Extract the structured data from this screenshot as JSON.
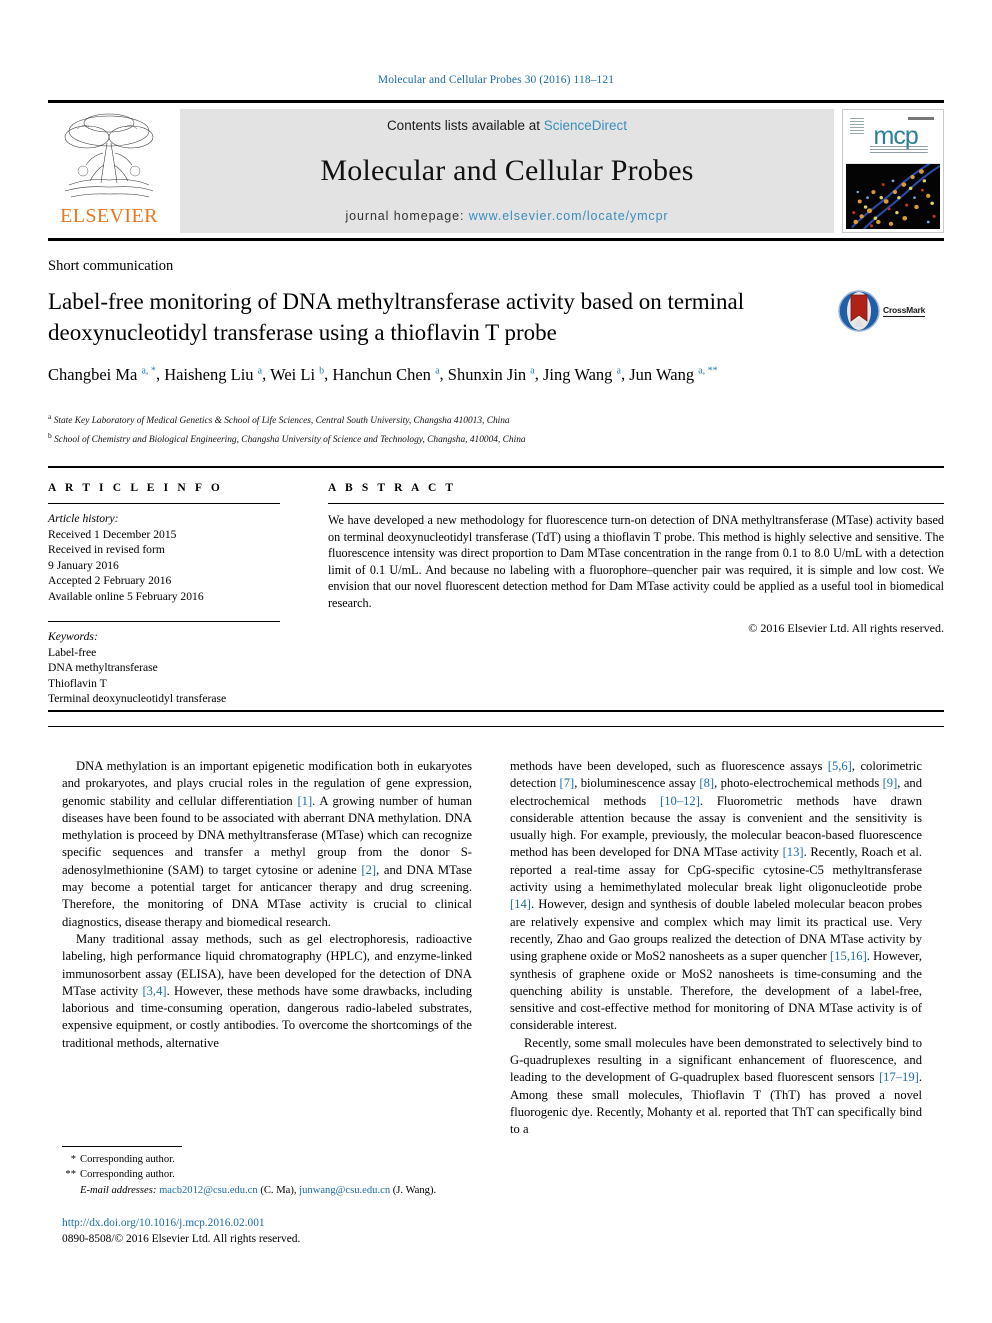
{
  "running_head": "Molecular and Cellular Probes 30 (2016) 118–121",
  "masthead": {
    "contents_prefix": "Contents lists available at ",
    "sciencedirect": "ScienceDirect",
    "journal_title": "Molecular and Cellular Probes",
    "homepage_prefix": "journal homepage: ",
    "homepage_url": "www.elsevier.com/locate/ymcpr",
    "publisher": "ELSEVIER",
    "cover_mark": "mcp"
  },
  "article": {
    "type": "Short communication",
    "title": "Label-free monitoring of DNA methyltransferase activity based on terminal deoxynucleotidyl transferase using a thioflavin T probe",
    "crossmark_label": "CrossMark",
    "authors_line_1": "Changbei Ma",
    "authors": [
      {
        "name": "Changbei Ma",
        "marks": "a, *"
      },
      {
        "name": "Haisheng Liu",
        "marks": "a"
      },
      {
        "name": "Wei Li",
        "marks": "b"
      },
      {
        "name": "Hanchun Chen",
        "marks": "a"
      },
      {
        "name": "Shunxin Jin",
        "marks": "a"
      },
      {
        "name": "Jing Wang",
        "marks": "a"
      },
      {
        "name": "Jun Wang",
        "marks": "a, **"
      }
    ],
    "affiliations": [
      {
        "mark": "a",
        "text": "State Key Laboratory of Medical Genetics & School of Life Sciences, Central South University, Changsha 410013, China"
      },
      {
        "mark": "b",
        "text": "School of Chemistry and Biological Engineering, Changsha University of Science and Technology, Changsha, 410004, China"
      }
    ]
  },
  "info": {
    "heading": "A R T I C L E   I N F O",
    "history_label": "Article history:",
    "history": [
      "Received 1 December 2015",
      "Received in revised form",
      "9 January 2016",
      "Accepted 2 February 2016",
      "Available online 5 February 2016"
    ],
    "keywords_label": "Keywords:",
    "keywords": [
      "Label-free",
      "DNA methyltransferase",
      "Thioflavin T",
      "Terminal deoxynucleotidyl transferase"
    ]
  },
  "abstract": {
    "heading": "A B S T R A C T",
    "text": "We have developed a new methodology for fluorescence turn-on detection of DNA methyltransferase (MTase) activity based on terminal deoxynucleotidyl transferase (TdT) using a thioflavin T probe. This method is highly selective and sensitive. The fluorescence intensity was direct proportion to Dam MTase concentration in the range from 0.1 to 8.0 U/mL with a detection limit of 0.1 U/mL. And because no labeling with a fluorophore–quencher pair was required, it is simple and low cost. We envision that our novel fluorescent detection method for Dam MTase activity could be applied as a useful tool in biomedical research.",
    "copyright": "© 2016 Elsevier Ltd. All rights reserved."
  },
  "body": {
    "left": [
      {
        "segments": [
          {
            "t": "DNA methylation is an important epigenetic modification both in eukaryotes and prokaryotes, and plays crucial roles in the regulation of gene expression, genomic stability and cellular differentiation "
          },
          {
            "t": "[1]",
            "ref": true
          },
          {
            "t": ". A growing number of human diseases have been found to be associated with aberrant DNA methylation. DNA methylation is proceed by DNA methyltransferase (MTase) which can recognize specific sequences and transfer a methyl group from the donor S-adenosylmethionine (SAM) to target cytosine or adenine "
          },
          {
            "t": "[2]",
            "ref": true
          },
          {
            "t": ", and DNA MTase may become a potential target for anticancer therapy and drug screening. Therefore, the monitoring of DNA MTase activity is crucial to clinical diagnostics, disease therapy and biomedical research."
          }
        ]
      },
      {
        "segments": [
          {
            "t": "Many traditional assay methods, such as gel electrophoresis, radioactive labeling, high performance liquid chromatography (HPLC), and enzyme-linked immunosorbent assay (ELISA), have been developed for the detection of DNA MTase activity "
          },
          {
            "t": "[3,4]",
            "ref": true
          },
          {
            "t": ". However, these methods have some drawbacks, including laborious and time-consuming operation, dangerous radio-labeled substrates, expensive equipment, or costly antibodies. To overcome the shortcomings of the traditional methods, alternative"
          }
        ]
      }
    ],
    "right": [
      {
        "segments": [
          {
            "t": "methods have been developed, such as fluorescence assays "
          },
          {
            "t": "[5,6]",
            "ref": true
          },
          {
            "t": ", colorimetric detection "
          },
          {
            "t": "[7]",
            "ref": true
          },
          {
            "t": ", bioluminescence assay "
          },
          {
            "t": "[8]",
            "ref": true
          },
          {
            "t": ", photo-electrochemical methods "
          },
          {
            "t": "[9]",
            "ref": true
          },
          {
            "t": ", and electrochemical methods "
          },
          {
            "t": "[10–12]",
            "ref": true
          },
          {
            "t": ". Fluorometric methods have drawn considerable attention because the assay is convenient and the sensitivity is usually high. For example, previously, the molecular beacon-based fluorescence method has been developed for DNA MTase activity "
          },
          {
            "t": "[13]",
            "ref": true
          },
          {
            "t": ". Recently, Roach et al. reported a real-time assay for CpG-specific cytosine-C5 methyltransferase activity using a hemimethylated molecular break light oligonucleotide probe "
          },
          {
            "t": "[14]",
            "ref": true
          },
          {
            "t": ". However, design and synthesis of double labeled molecular beacon probes are relatively expensive and complex which may limit its practical use. Very recently, Zhao and Gao groups realized the detection of DNA MTase activity by using graphene oxide or MoS2 nanosheets as a super quencher "
          },
          {
            "t": "[15,16]",
            "ref": true
          },
          {
            "t": ". However, synthesis of graphene oxide or MoS2 nanosheets is time-consuming and the quenching ability is unstable. Therefore, the development of a label-free, sensitive and cost-effective method for monitoring of DNA MTase activity is of considerable interest."
          }
        ]
      },
      {
        "segments": [
          {
            "t": "Recently, some small molecules have been demonstrated to selectively bind to G-quadruplexes resulting in a significant enhancement of fluorescence, and leading to the development of G-quadruplex based fluorescent sensors "
          },
          {
            "t": "[17–19]",
            "ref": true
          },
          {
            "t": ". Among these small molecules, Thioflavin T (ThT) has proved a novel fluorogenic dye. Recently, Mohanty et al. reported that ThT can specifically bind to a"
          }
        ]
      }
    ]
  },
  "footnotes": {
    "line1_mark": "*",
    "line1": "Corresponding author.",
    "line2_mark": "**",
    "line2": "Corresponding author.",
    "email_label": "E-mail addresses:",
    "email1": "macb2012@csu.edu.cn",
    "email1_who": "(C. Ma)",
    "email2": "junwang@csu.edu.cn",
    "email2_who": "(J. Wang)."
  },
  "doi": {
    "url": "http://dx.doi.org/10.1016/j.mcp.2016.02.001",
    "issn_line": "0890-8508/© 2016 Elsevier Ltd. All rights reserved."
  },
  "colors": {
    "link": "#1a6ca8",
    "sciencedirect": "#3a8ec0",
    "elsevier_orange": "#e87722",
    "band_gray": "#e3e3e3",
    "cover_teal": "#2b7f96"
  }
}
